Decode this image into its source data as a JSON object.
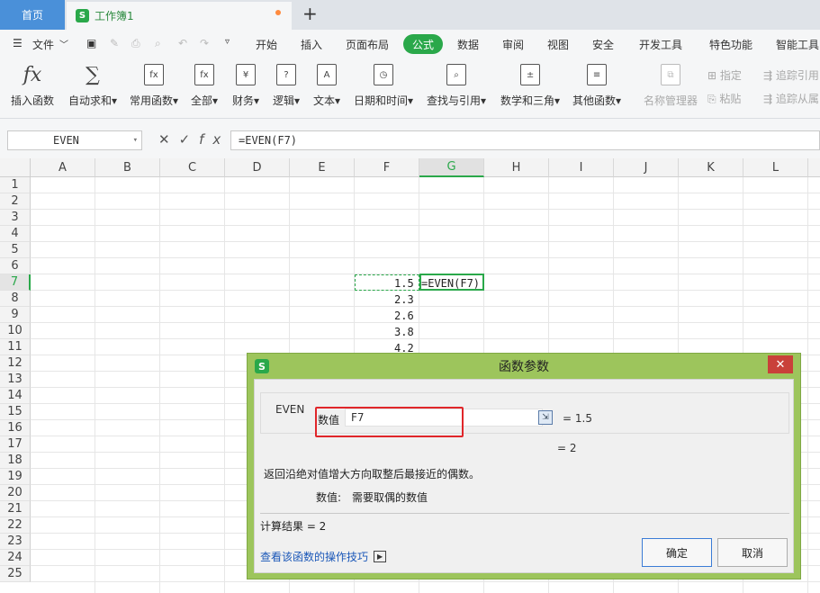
{
  "tabs": {
    "home": "首页",
    "doc": "工作簿1",
    "add": "+"
  },
  "menu": {
    "file": "文件",
    "items": [
      "开始",
      "插入",
      "页面布局",
      "公式",
      "数据",
      "审阅",
      "视图",
      "安全",
      "开发工具",
      "特色功能",
      "智能工具"
    ],
    "active": "公式"
  },
  "ribbon": {
    "buttons": [
      {
        "label": "插入函数",
        "icon": "fx-icon"
      },
      {
        "label": "自动求和",
        "icon": "sigma-icon"
      },
      {
        "label": "常用函数",
        "icon": "function-icon"
      },
      {
        "label": "全部",
        "icon": "fx-box-icon"
      },
      {
        "label": "财务",
        "icon": "yen-icon"
      },
      {
        "label": "逻辑",
        "icon": "question-icon"
      },
      {
        "label": "文本",
        "icon": "text-a-icon"
      },
      {
        "label": "日期和时间",
        "icon": "clock-icon"
      },
      {
        "label": "查找与引用",
        "icon": "lookup-icon"
      },
      {
        "label": "数学和三角",
        "icon": "math-icon"
      },
      {
        "label": "其他函数",
        "icon": "more-icon"
      },
      {
        "label": "名称管理器",
        "icon": "name-manager-icon"
      }
    ],
    "small": [
      "指定",
      "粘贴",
      "追踪引用",
      "追踪从属"
    ]
  },
  "formula_bar": {
    "name_box": "EVEN",
    "formula": "=EVEN(F7)"
  },
  "grid": {
    "columns": [
      "A",
      "B",
      "C",
      "D",
      "E",
      "F",
      "G",
      "H",
      "I",
      "J",
      "K",
      "L"
    ],
    "rows": [
      "1",
      "2",
      "3",
      "4",
      "5",
      "6",
      "7",
      "8",
      "9",
      "10",
      "11",
      "12",
      "13",
      "14",
      "15",
      "16",
      "17",
      "18",
      "19",
      "20",
      "21",
      "22",
      "23",
      "24",
      "25"
    ],
    "selected_col": "G",
    "selected_row": "7",
    "f_values": [
      "1.5",
      "2.3",
      "2.6",
      "3.8",
      "4.2"
    ],
    "g7": "=EVEN(F7)"
  },
  "dialog": {
    "title": "函数参数",
    "close": "✕",
    "fn_name": "EVEN",
    "param_label": "数值",
    "param_value": "F7",
    "param_result": "= 1.5",
    "fn_result": "= 2",
    "description": "返回沿绝对值增大方向取整后最接近的偶数。",
    "param_desc_name": "数值:",
    "param_desc_text": "需要取偶的数值",
    "calc_result": "计算结果 = 2",
    "tips_link": "查看该函数的操作技巧",
    "ok": "确定",
    "cancel": "取消"
  }
}
